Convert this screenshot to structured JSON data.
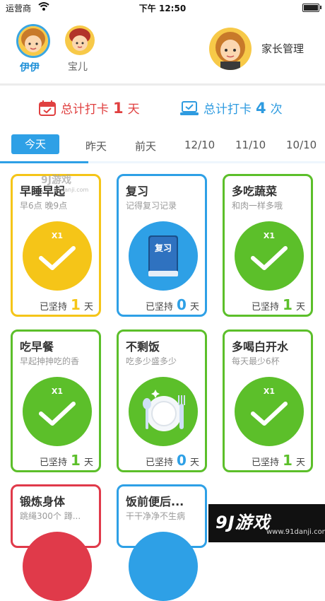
{
  "status_bar": {
    "carrier": "运营商",
    "time": "下午 12:50"
  },
  "profiles": {
    "kids": [
      {
        "name": "伊伊",
        "selected": true
      },
      {
        "name": "宝儿",
        "selected": false
      }
    ],
    "parent_label": "家长管理"
  },
  "totals": {
    "days": {
      "prefix": "总计打卡",
      "value": "1",
      "unit": "天"
    },
    "times": {
      "prefix": "总计打卡",
      "value": "4",
      "unit": "次"
    }
  },
  "date_tabs": [
    "今天",
    "昨天",
    "前天",
    "12/10",
    "11/10",
    "10/10"
  ],
  "streak_prefix": "已坚持",
  "streak_unit": "天",
  "habits": [
    {
      "title": "早睡早起",
      "subtitle": "早6点 晚9点",
      "badge": "X1",
      "streak": "1",
      "color": "#f5c518",
      "icon": "check-icon"
    },
    {
      "title": "复习",
      "subtitle": "记得复习记录",
      "badge": "",
      "streak": "0",
      "color": "#2ea0e6",
      "icon": "review-book-icon",
      "icon_text": "复习"
    },
    {
      "title": "多吃蔬菜",
      "subtitle": "和肉一样多哦",
      "badge": "X1",
      "streak": "1",
      "color": "#5cbf2a",
      "icon": "check-icon"
    },
    {
      "title": "吃早餐",
      "subtitle": "早起抻抻吃的香",
      "badge": "X1",
      "streak": "1",
      "color": "#5cbf2a",
      "icon": "check-icon"
    },
    {
      "title": "不剩饭",
      "subtitle": "吃多少盛多少",
      "badge": "",
      "streak": "0",
      "color": "#5cbf2a",
      "icon": "plate-utensils-icon"
    },
    {
      "title": "多喝白开水",
      "subtitle": "每天最少6杯",
      "badge": "X1",
      "streak": "1",
      "color": "#5cbf2a",
      "icon": "check-icon"
    },
    {
      "title": "锻炼身体",
      "subtitle": "跳绳300个 蹲...",
      "color": "#e03a4a"
    },
    {
      "title": "饭前便后...",
      "subtitle": "干干净净不生病",
      "color": "#2ea0e6"
    }
  ],
  "watermark": {
    "text": "9J游戏",
    "url": "91danji.com"
  },
  "brand": {
    "logo": "9J游戏",
    "url": "www.91danji.com"
  }
}
